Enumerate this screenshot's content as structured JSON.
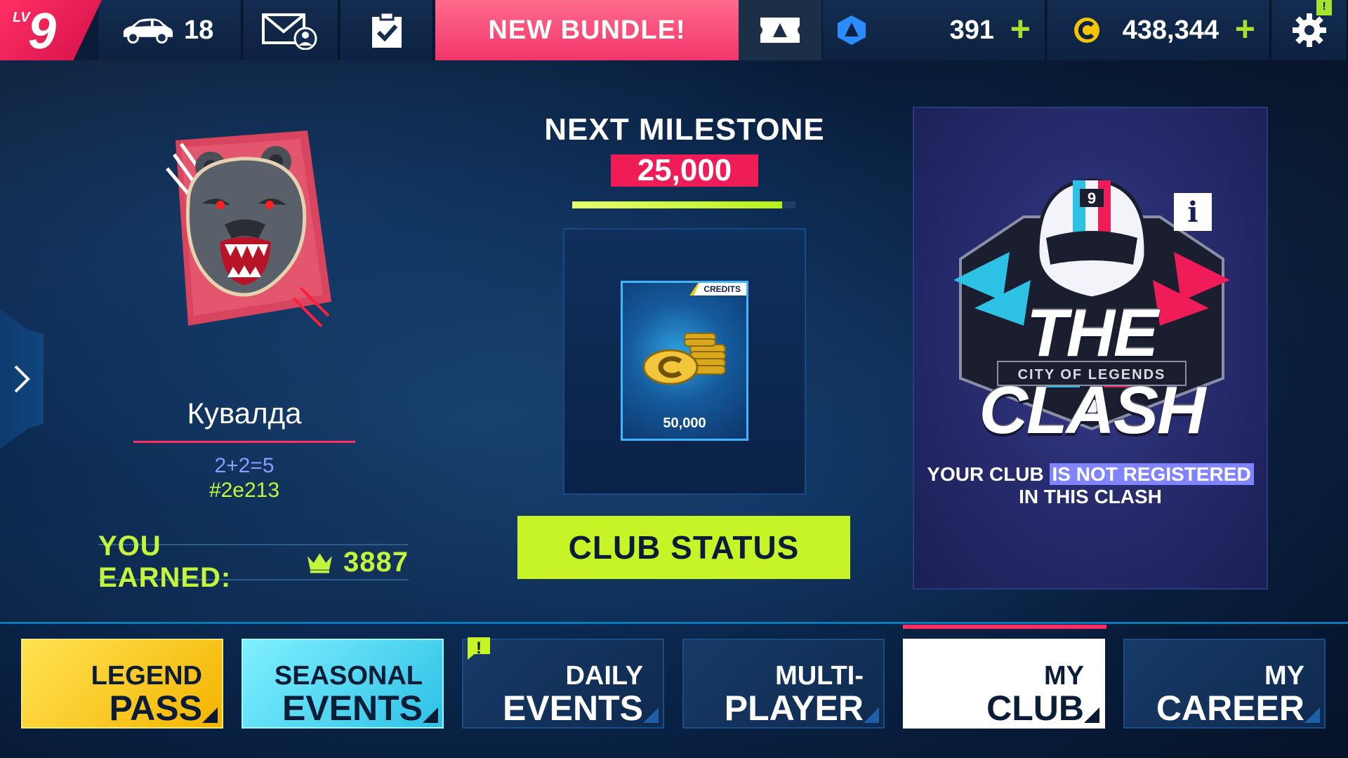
{
  "topbar": {
    "level_prefix": "LV",
    "level": "9",
    "cars_count": "18",
    "bundle_label": "NEW BUNDLE!",
    "tokens": "391",
    "credits": "438,344",
    "settings_badge": "!"
  },
  "player": {
    "name": "Кувалда",
    "club_name": "2+2=5",
    "club_tag": "#2e213",
    "earned_label": "YOU EARNED:",
    "earned_value": "3887"
  },
  "milestone": {
    "title": "NEXT MILESTONE",
    "value": "25,000",
    "progress": 0.94,
    "reward_tag": "CREDITS",
    "reward_amount": "50,000"
  },
  "club_status_label": "CLUB STATUS",
  "clash": {
    "title": "THE CLASH",
    "subtitle": "CITY OF LEGENDS",
    "info": "i",
    "msg_part1": "YOUR CLUB",
    "msg_highlight": "IS NOT REGISTERED",
    "msg_part2": "IN THIS CLASH",
    "helmet_number": "9"
  },
  "nav": [
    {
      "line1": "LEGEND",
      "line2": "PASS"
    },
    {
      "line1": "SEASONAL",
      "line2": "EVENTS"
    },
    {
      "line1": "DAILY",
      "line2": "EVENTS",
      "badge": "!"
    },
    {
      "line1": "MULTI-",
      "line2": "PLAYER"
    },
    {
      "line1": "MY",
      "line2": "CLUB"
    },
    {
      "line1": "MY",
      "line2": "CAREER"
    }
  ],
  "colors": {
    "accent_pink": "#ff2f64",
    "accent_lime": "#c6f426",
    "gold": "#f4b400",
    "cyan": "#2ec1e6"
  }
}
